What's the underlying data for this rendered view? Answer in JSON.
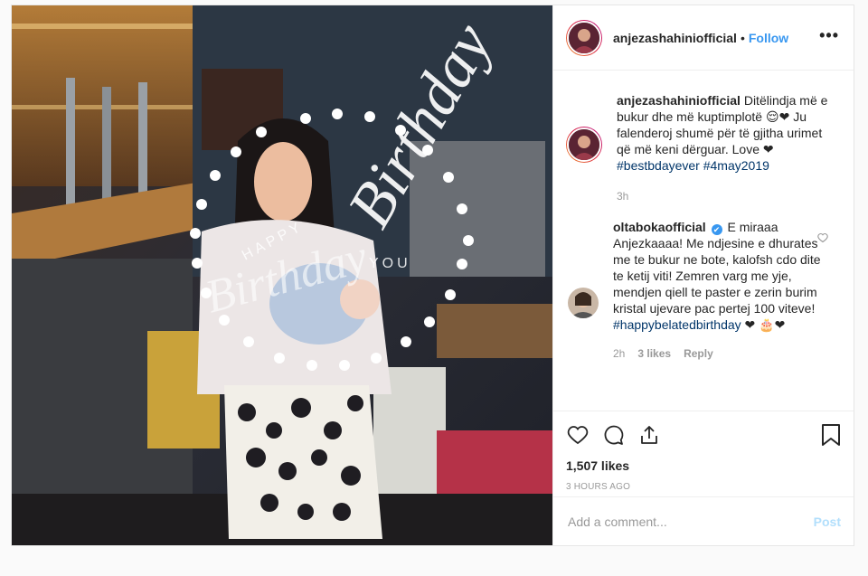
{
  "header": {
    "username": "anjezashahiniofficial",
    "separator": "•",
    "follow_label": "Follow",
    "more_icon": "more-options-icon"
  },
  "photo": {
    "overlay_text_top": "HAPPY",
    "overlay_text_main": "Birthday",
    "overlay_text_side": "Birthday",
    "overlay_text_bottom": "YOU"
  },
  "caption": {
    "username": "anjezashahiniofficial",
    "text": " Ditëlindja më e bukur dhe më kuptimplotë 😌❤ Ju falenderoj shumë për të gjitha urimet që më keni dërguar. Love ❤ ",
    "tag1": "#bestbdayever",
    "tag2": "#4may2019",
    "time": "3h"
  },
  "comment": {
    "username": "oltabokaofficial",
    "verified": "✔",
    "text": " E miraaa Anjezkaaaa! Me ndjesine e dhurates me te bukur ne bote, kalofsh cdo dite te ketij viti! Zemren varg me yje, mendjen qiell te paster e zerin burim kristal ujevare pac pertej 100 viteve! ",
    "tag": "#happybelatedbirthday",
    "suffix": " ❤ 🎂❤",
    "time": "2h",
    "likes": "3 likes",
    "reply_label": "Reply"
  },
  "actions": {
    "likes_text": "1,507 likes",
    "timestamp": "3 HOURS AGO"
  },
  "add_comment": {
    "placeholder": "Add a comment...",
    "post_label": "Post"
  },
  "colors": {
    "accent": "#3897f0",
    "hashtag": "#003569",
    "post_disabled": "#b2dffc"
  }
}
